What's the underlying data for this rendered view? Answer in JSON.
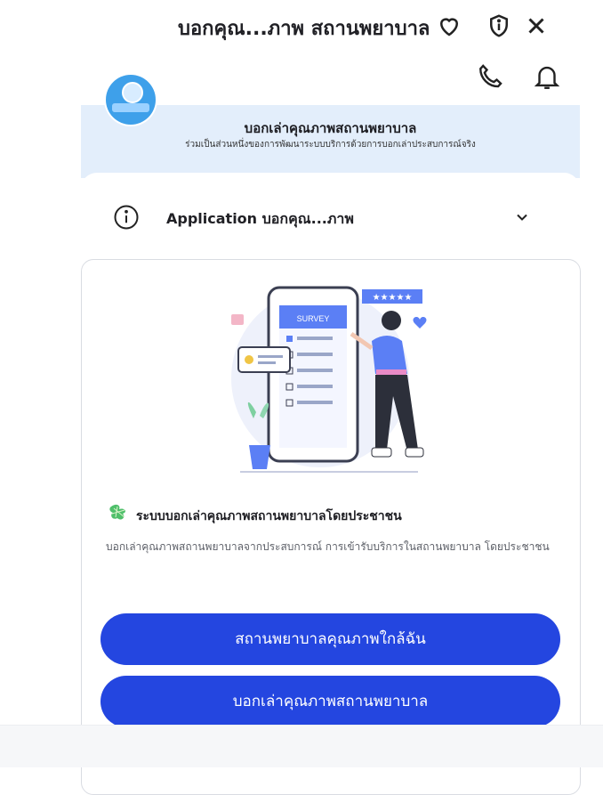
{
  "header": {
    "title": "บอกคุณ...ภาพ สถานพยาบาล"
  },
  "icons": {
    "heart": "heart-icon",
    "shield": "shield-info-icon",
    "close": "close-icon",
    "phone": "phone-icon",
    "bell": "bell-icon",
    "info": "info-icon",
    "chevron": "chevron-down-icon"
  },
  "banner": {
    "title": "บอกเล่าคุณภาพสถานพยาบาล",
    "subtitle": "ร่วมเป็นส่วนหนึ่งของการพัฒนาระบบบริการด้วยการบอกเล่าประสบการณ์จริง"
  },
  "app_selector": {
    "label": "Application บอกคุณ...ภาพ"
  },
  "card": {
    "illustration_label": "SURVEY",
    "system_title": "ระบบบอกเล่าคุณภาพสถานพยาบาลโดยประชาชน",
    "system_description": "บอกเล่าคุณภาพสถานพยาบาลจากประสบการณ์ การเข้ารับบริการในสถานพยาบาล โดยประชาชน"
  },
  "buttons": {
    "nearby": "สถานพยาบาลคุณภาพใกล้ฉัน",
    "report": "บอกเล่าคุณภาพสถานพยาบาล"
  },
  "colors": {
    "primary": "#2446e0",
    "banner_bg": "#e3eefb",
    "accent_blue": "#5b7ff5"
  }
}
